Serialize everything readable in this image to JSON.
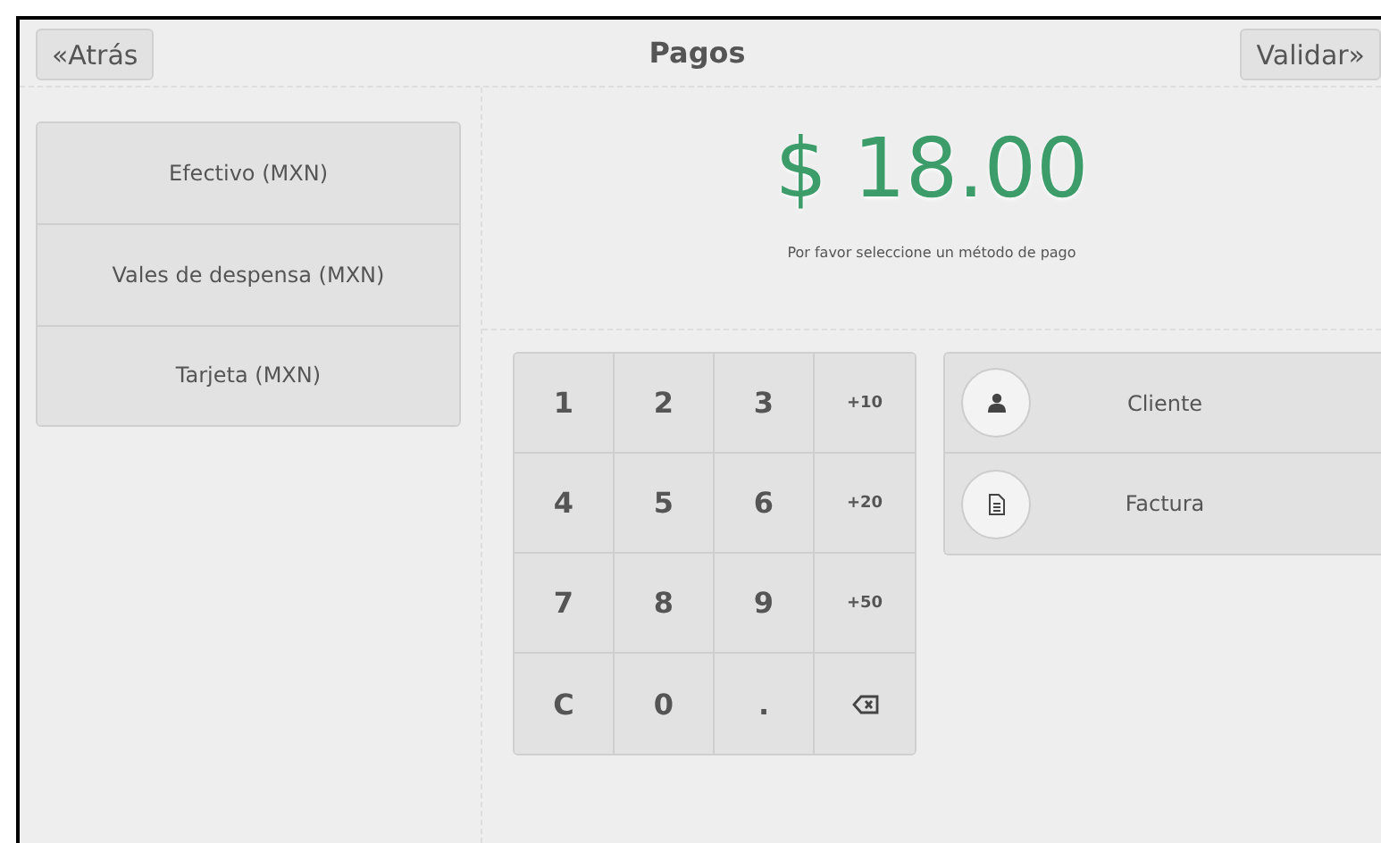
{
  "header": {
    "back_button": "«Atrás",
    "title": "Pagos",
    "validate_button": "Validar»"
  },
  "payment_methods": [
    {
      "label": "Efectivo (MXN)",
      "selected": false
    },
    {
      "label": "Vales de despensa (MXN)",
      "selected": false
    },
    {
      "label": "Tarjeta (MXN)",
      "selected": false
    }
  ],
  "amount": "$ 18.00",
  "message": "Por favor seleccione un método de pago",
  "keypad": [
    {
      "kind": "digit",
      "label": "1"
    },
    {
      "kind": "digit",
      "label": "2"
    },
    {
      "kind": "digit",
      "label": "3"
    },
    {
      "kind": "add",
      "label": "+10"
    },
    {
      "kind": "digit",
      "label": "4"
    },
    {
      "kind": "digit",
      "label": "5"
    },
    {
      "kind": "digit",
      "label": "6"
    },
    {
      "kind": "add",
      "label": "+20"
    },
    {
      "kind": "digit",
      "label": "7"
    },
    {
      "kind": "digit",
      "label": "8"
    },
    {
      "kind": "digit",
      "label": "9"
    },
    {
      "kind": "add",
      "label": "+50"
    },
    {
      "kind": "digit",
      "label": "C"
    },
    {
      "kind": "digit",
      "label": "0"
    },
    {
      "kind": "digit",
      "label": "."
    },
    {
      "kind": "backspace"
    }
  ],
  "actions": [
    {
      "kind": "customer",
      "label": "Cliente"
    },
    {
      "kind": "invoice",
      "label": "Factura"
    }
  ]
}
